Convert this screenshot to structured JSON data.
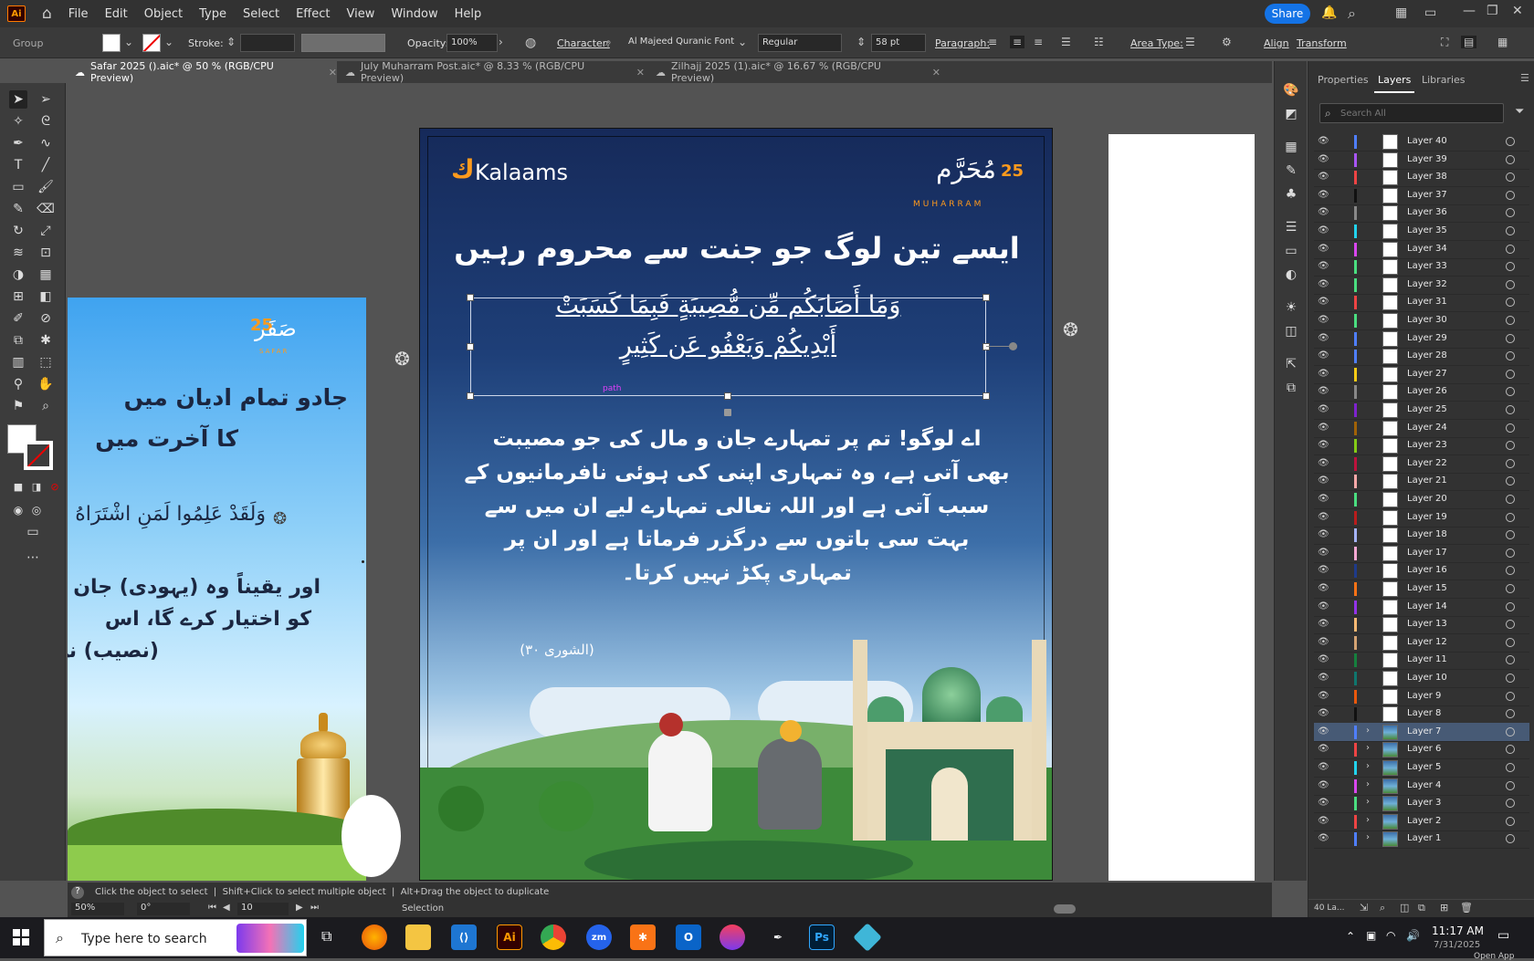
{
  "menubar": {
    "logo": "Ai",
    "items": [
      "File",
      "Edit",
      "Object",
      "Type",
      "Select",
      "Effect",
      "View",
      "Window",
      "Help"
    ],
    "share_label": "Share"
  },
  "control_bar": {
    "selection_label": "Group",
    "stroke_label": "Stroke:",
    "opacity_label": "Opacity:",
    "opacity_value": "100%",
    "character_label": "Character:",
    "font_name": "Al Majeed Quranic Font...",
    "font_style": "Regular",
    "font_size": "58 pt",
    "paragraph_label": "Paragraph:",
    "area_type_label": "Area Type:",
    "align_label": "Align",
    "transform_label": "Transform"
  },
  "tabs": [
    {
      "label": "Safar 2025 ().aic* @ 50 % (RGB/CPU Preview)"
    },
    {
      "label": "July Muharram Post.aic* @ 8.33 % (RGB/CPU Preview)"
    },
    {
      "label": "Zilhajj 2025 (1).aic* @ 16.67 % (RGB/CPU Preview)"
    }
  ],
  "artboard_main": {
    "brand": "Kalaams",
    "badge_number": "25",
    "badge_script": "مُحَرَّم",
    "badge_en": "MUHARRAM",
    "headline": "ایسے تین لوگ جو جنت سے محروم رہیں",
    "ayah_line1": "وَمَا أَصَابَكُم مِّن مُّصِيبَةٍ فَبِمَا كَسَبَتْ",
    "ayah_line2": "أَيْدِيكُمْ وَيَعْفُو عَن كَثِيرٍ",
    "selection_tag": "path",
    "translation": [
      "اے لوگو! تم پر تمہارے جان و مال کی جو مصیبت",
      "بھی آتی ہے، وہ تمہاری اپنی کی ہوئی نافرمانیوں کے",
      "سبب آتی ہے اور اللہ تعالی تمہارے لیے ان میں سے",
      "بہت سی باتوں سے درگزر فرماتا ہے اور ان پر",
      "تمہاری پکڑ نہیں کرتا۔"
    ],
    "reference": "(الشوری ۳۰)"
  },
  "artboard_left": {
    "badge_number": "25",
    "badge_script": "صَفَر",
    "badge_en": "SAFAR",
    "line1": "جادو تمام ادیان میں",
    "line2": "کا آخرت میں",
    "ayah": "وَلَقَدْ عَلِمُوا لَمَنِ اشْتَرَاهُ",
    "trans1": "اور یقیناً وہ (یہودی) جان",
    "trans2": "کو اختیار کرے گا، اس",
    "trans3": "(نصیب) نہ"
  },
  "panel": {
    "tabs": [
      "Properties",
      "Layers",
      "Libraries"
    ],
    "search_placeholder": "Search All",
    "layers": [
      {
        "name": "Layer 40",
        "color": "#4f7fff"
      },
      {
        "name": "Layer 39",
        "color": "#a855f7"
      },
      {
        "name": "Layer 38",
        "color": "#ef4444"
      },
      {
        "name": "Layer 37",
        "color": "#111111"
      },
      {
        "name": "Layer 36",
        "color": "#888888"
      },
      {
        "name": "Layer 35",
        "color": "#22d3ee"
      },
      {
        "name": "Layer 34",
        "color": "#d946ef"
      },
      {
        "name": "Layer 33",
        "color": "#4ade80"
      },
      {
        "name": "Layer 32",
        "color": "#4ade80"
      },
      {
        "name": "Layer 31",
        "color": "#ef4444"
      },
      {
        "name": "Layer 30",
        "color": "#4ade80"
      },
      {
        "name": "Layer 29",
        "color": "#4f7fff"
      },
      {
        "name": "Layer 28",
        "color": "#4f7fff"
      },
      {
        "name": "Layer 27",
        "color": "#facc15"
      },
      {
        "name": "Layer 26",
        "color": "#888888"
      },
      {
        "name": "Layer 25",
        "color": "#7e22ce"
      },
      {
        "name": "Layer 24",
        "color": "#a16207"
      },
      {
        "name": "Layer 23",
        "color": "#84cc16"
      },
      {
        "name": "Layer 22",
        "color": "#be123c"
      },
      {
        "name": "Layer 21",
        "color": "#f9a8a8"
      },
      {
        "name": "Layer 20",
        "color": "#4ade80"
      },
      {
        "name": "Layer 19",
        "color": "#b91c1c"
      },
      {
        "name": "Layer 18",
        "color": "#a5b4fc"
      },
      {
        "name": "Layer 17",
        "color": "#f9a8d4"
      },
      {
        "name": "Layer 16",
        "color": "#1e3a8a"
      },
      {
        "name": "Layer 15",
        "color": "#f97316"
      },
      {
        "name": "Layer 14",
        "color": "#9333ea"
      },
      {
        "name": "Layer 13",
        "color": "#fdba74"
      },
      {
        "name": "Layer 12",
        "color": "#d4a373"
      },
      {
        "name": "Layer 11",
        "color": "#15803d"
      },
      {
        "name": "Layer 10",
        "color": "#0f766e"
      },
      {
        "name": "Layer 9",
        "color": "#ea580c"
      },
      {
        "name": "Layer 8",
        "color": "#111111"
      },
      {
        "name": "Layer 7",
        "color": "#4f7fff",
        "selected": true,
        "expandable": true
      },
      {
        "name": "Layer 6",
        "color": "#ef4444",
        "expandable": true
      },
      {
        "name": "Layer 5",
        "color": "#22d3ee",
        "expandable": true
      },
      {
        "name": "Layer 4",
        "color": "#d946ef",
        "expandable": true
      },
      {
        "name": "Layer 3",
        "color": "#4ade80",
        "expandable": true
      },
      {
        "name": "Layer 2",
        "color": "#ef4444",
        "expandable": true
      },
      {
        "name": "Layer 1",
        "color": "#4f7fff",
        "expandable": true
      }
    ],
    "footer_count": "40 La..."
  },
  "statusbar": {
    "hint": "Click the object to select  |  Shift+Click to select multiple object  |  Alt+Drag the object to duplicate",
    "zoom": "50%",
    "rotation": "0°",
    "artboard": "10",
    "tool": "Selection"
  },
  "taskbar": {
    "search_placeholder": "Type here to search",
    "time": "11:17 AM",
    "date": "7/31/2025",
    "open_app": "Open App"
  }
}
